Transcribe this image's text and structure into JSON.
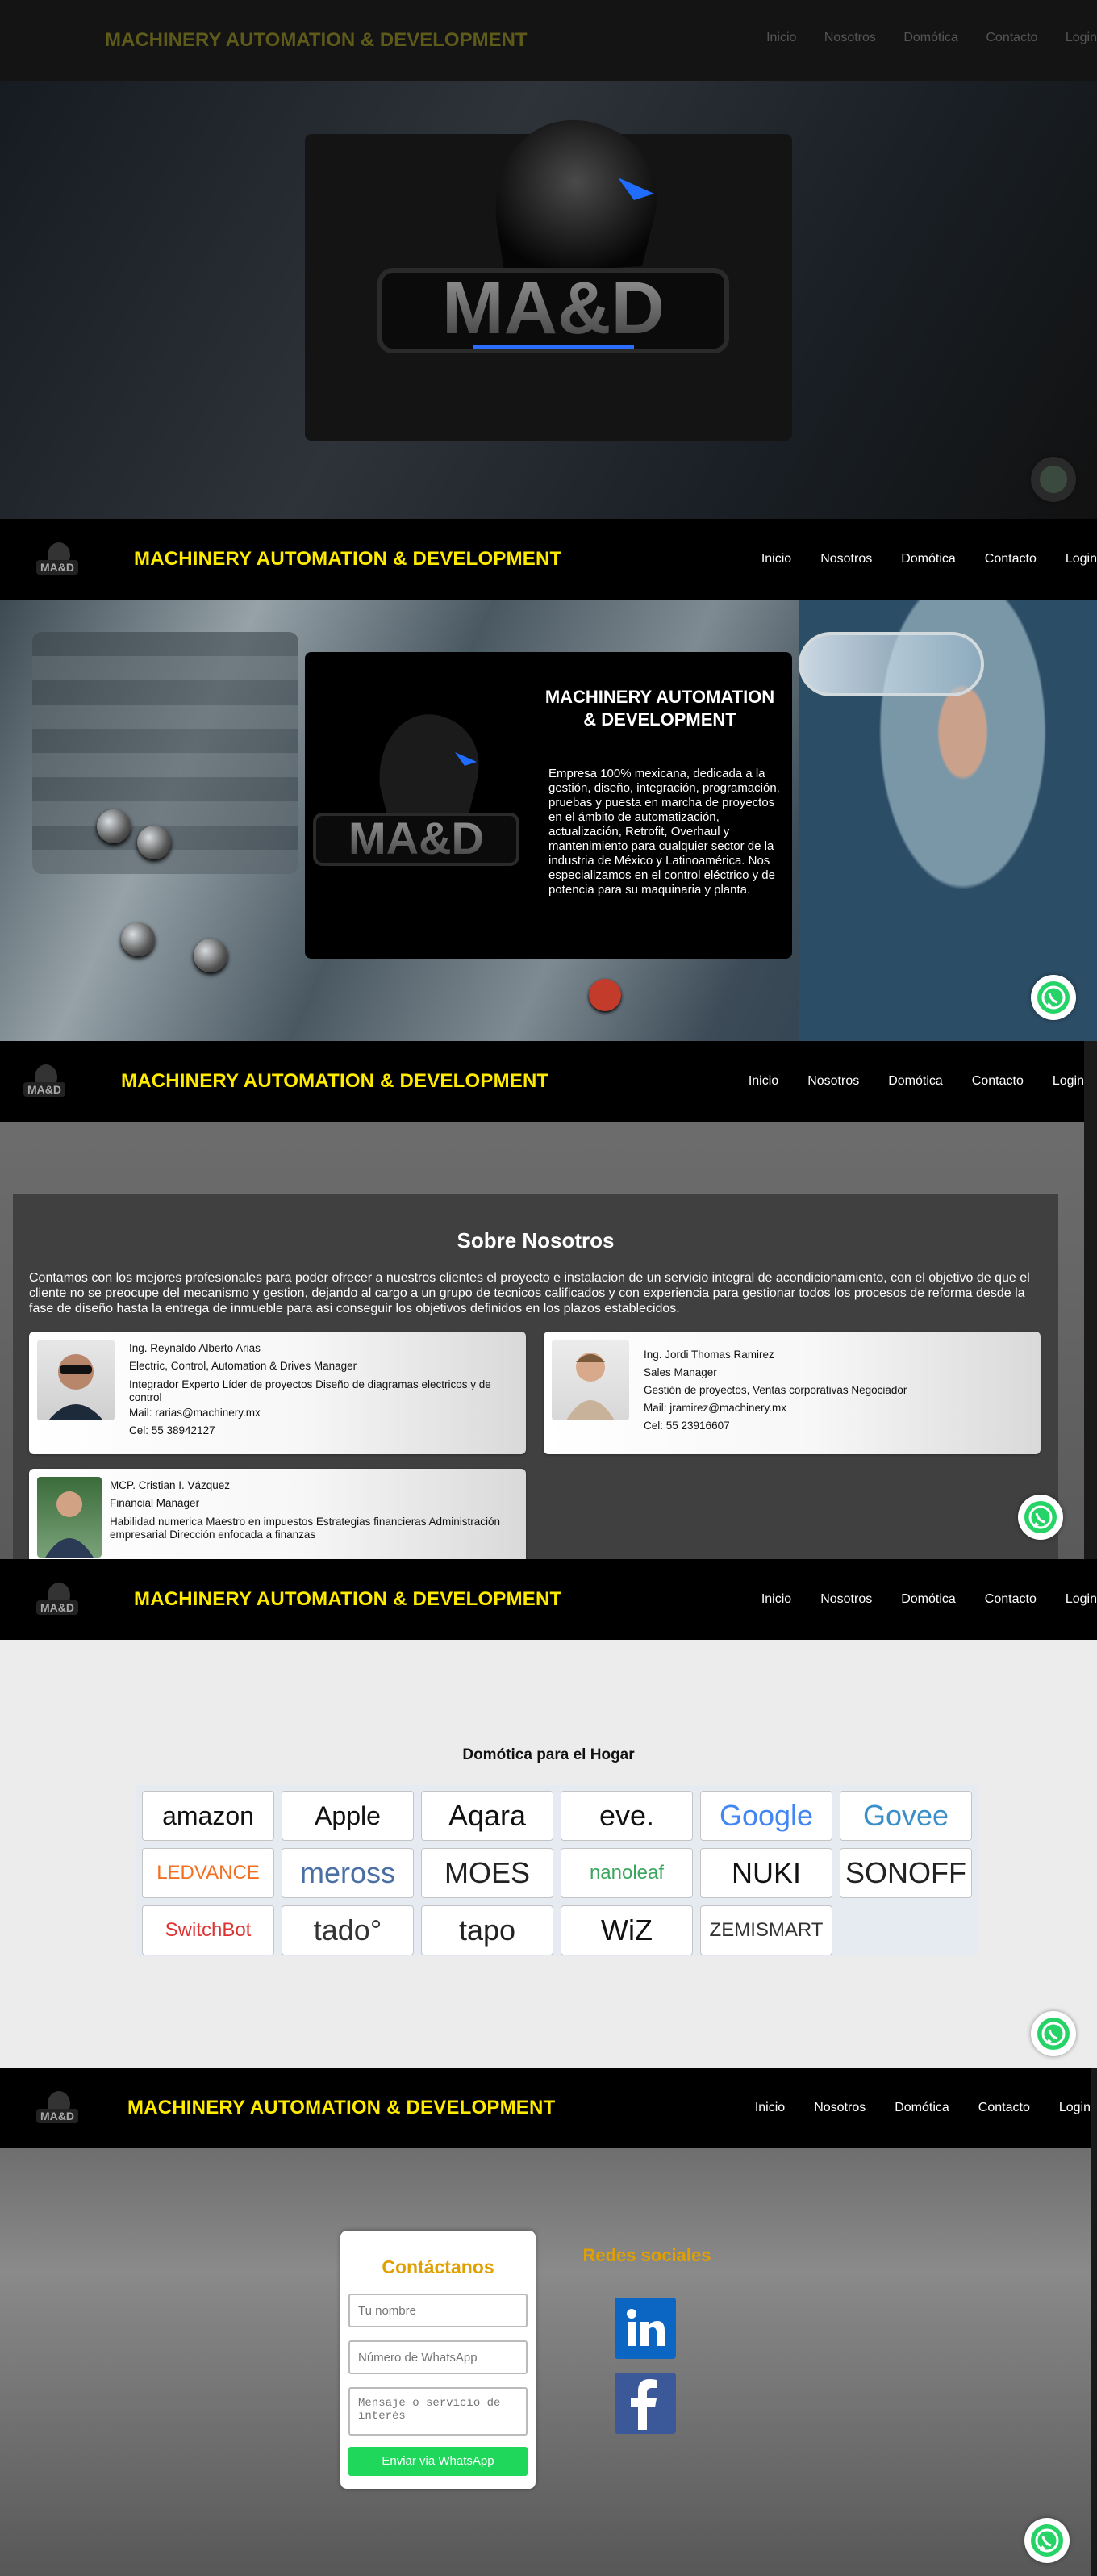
{
  "nav": {
    "brand": "MACHINERY AUTOMATION & DEVELOPMENT",
    "links": [
      "Inicio",
      "Nosotros",
      "Domótica",
      "Contacto",
      "Login"
    ]
  },
  "logo": {
    "text": "MA&D"
  },
  "hero": {
    "title": "MACHINERY AUTOMATION & DEVELOPMENT",
    "description": "Empresa 100% mexicana, dedicada a la gestión, diseño, integración, programación, pruebas y puesta en marcha de proyectos en el ámbito de automatización, actualización, Retrofit, Overhaul y mantenimiento para cualquier sector de la industria de México y Latinoamérica. Nos especializamos en el control eléctrico y de potencia para su maquinaria y planta."
  },
  "about": {
    "title": "Sobre Nosotros",
    "description": "Contamos con los mejores profesionales para poder ofrecer a nuestros clientes el proyecto e instalacion de un servicio integral de acondicionamiento, con el objetivo de que el cliente no se preocupe del mecanismo y gestion, dejando al cargo a un grupo de tecnicos calificados y con experiencia para gestionar todos los procesos de reforma desde la fase de diseño hasta la entrega de inmueble para asi conseguir los objetivos definidos en los plazos establecidos.",
    "members": [
      {
        "name": "Ing. Reynaldo Alberto Arias",
        "role": "Electric, Control, Automation & Drives Manager",
        "line1": "Integrador Experto Líder de proyectos Diseño de diagramas electricos y de",
        "line2": "control",
        "mail": "Mail: rarias@machinery.mx",
        "cel": "Cel: 55 38942127"
      },
      {
        "name": "Ing. Jordi Thomas Ramirez",
        "role": "Sales Manager",
        "line1": "Gestión de proyectos, Ventas corporativas Negociador",
        "line2": "",
        "mail": "Mail: jramirez@machinery.mx",
        "cel": "Cel: 55 23916607"
      },
      {
        "name": "MCP. Cristian I. Vázquez",
        "role": "Financial Manager",
        "line1": "Habilidad numerica Maestro en impuestos Estrategias financieras Administración",
        "line2": "empresarial Dirección enfocada a finanzas",
        "mail": "",
        "cel": ""
      }
    ]
  },
  "domotica": {
    "title": "Domótica para el Hogar",
    "brands": [
      "amazon",
      "Apple",
      "Aqara",
      "eve.",
      "Google",
      "Govee",
      "LEDVANCE",
      "meross",
      "MOES",
      "nanoleaf",
      "NUKI",
      "SONOFF",
      "SwitchBot",
      "tado°",
      "tapo",
      "WiZ",
      "ZEMISMART"
    ],
    "brand_colors": {
      "amazon": "#111111",
      "Apple": "#111111",
      "Aqara": "#111111",
      "eve.": "#111111",
      "Google": "#4285f4",
      "Govee": "#3a8fc9",
      "LEDVANCE": "#f36f21",
      "meross": "#4a6fa5",
      "MOES": "#222222",
      "nanoleaf": "#3aa55d",
      "NUKI": "#111111",
      "SONOFF": "#222222",
      "SwitchBot": "#d33",
      "tado°": "#333333",
      "tapo": "#222222",
      "WiZ": "#111111",
      "ZEMISMART": "#333333"
    }
  },
  "contact": {
    "title": "Contáctanos",
    "name_placeholder": "Tu nombre",
    "phone_placeholder": "Número de WhatsApp",
    "message_placeholder": "Mensaje o servicio de interés",
    "submit": "Enviar via WhatsApp",
    "social_title": "Redes sociales"
  },
  "colors": {
    "brand_yellow": "#ffeb00",
    "accent_orange": "#e0a000",
    "whatsapp_green": "#25d366",
    "linkedin": "#0a66c2",
    "facebook": "#3b5998"
  }
}
